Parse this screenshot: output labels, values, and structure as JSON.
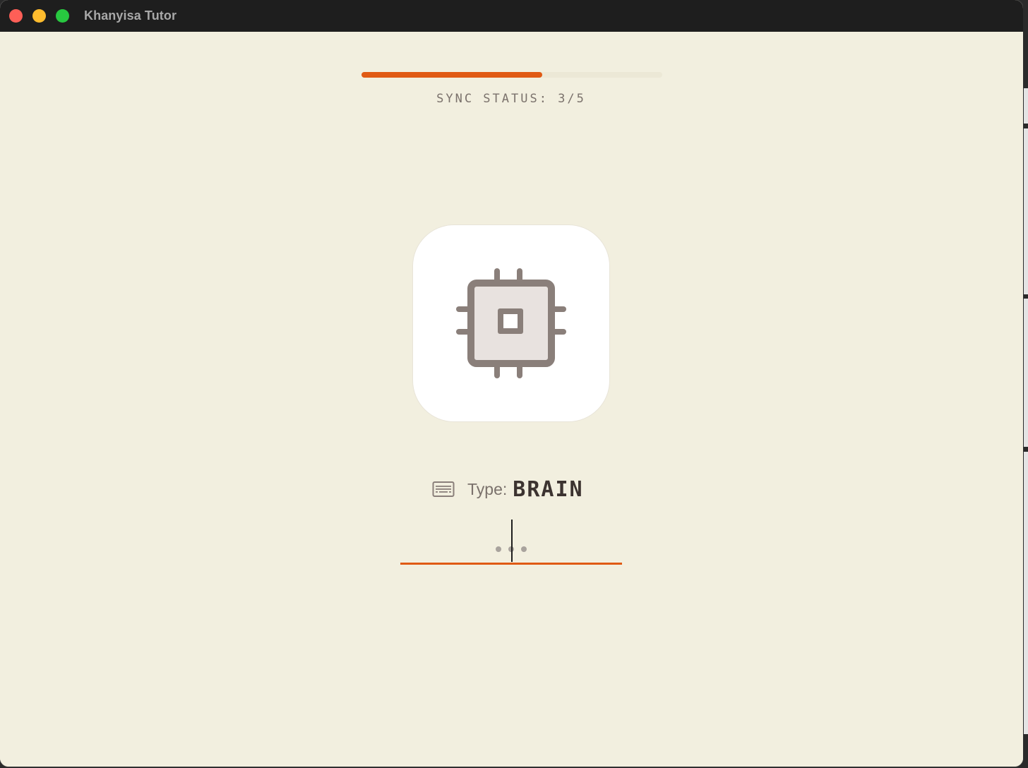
{
  "window": {
    "title": "Khanyisa Tutor",
    "controls": {
      "close_icon": "close-traffic-light",
      "minimize_icon": "minimize-traffic-light",
      "zoom_icon": "zoom-traffic-light"
    }
  },
  "progress": {
    "fraction": 0.6,
    "status_text": "SYNC STATUS: 3/5",
    "accent_color": "#e05a14"
  },
  "card": {
    "icon": "cpu-chip-icon"
  },
  "prompt": {
    "keyboard_icon": "keyboard-icon",
    "type_label": "Type:",
    "target_word": "BRAIN"
  },
  "answer": {
    "value": "",
    "placeholder_icon": "typing-dots"
  },
  "colors": {
    "background": "#f2efdf",
    "accent": "#e05a14",
    "icon": "#8a7f7a",
    "text_muted": "#7b726c",
    "text_strong": "#3c3330"
  }
}
